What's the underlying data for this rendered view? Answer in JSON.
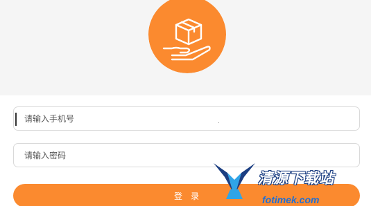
{
  "colors": {
    "accent": "#fb8a2f",
    "logo_bg": "#fb8a2f",
    "top_background": "#f5f5f5",
    "field_border": "#d9d9d9"
  },
  "logo": {
    "icon": "hand-holding-box-icon"
  },
  "form": {
    "phone_placeholder": "请输入手机号",
    "password_placeholder": "请输入密码",
    "login_label": "登录"
  },
  "watermark": {
    "text": "清源下载站",
    "url": "fotimek.com",
    "icon": "watermark-logo-icon"
  }
}
